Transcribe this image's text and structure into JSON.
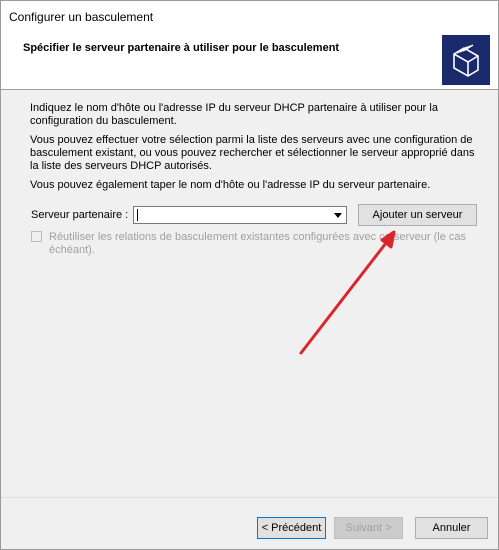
{
  "window": {
    "title": "Configurer un basculement"
  },
  "header": {
    "title": "Spécifier le serveur partenaire à utiliser pour le basculement",
    "icon": "folders-icon"
  },
  "content": {
    "paragraph1": "Indiquez le nom d'hôte ou l'adresse IP du serveur DHCP partenaire à utiliser pour la configuration du basculement.",
    "paragraph2": "Vous pouvez effectuer votre sélection parmi la liste des serveurs avec une configuration de basculement existant, ou vous pouvez rechercher et sélectionner le serveur approprié dans la liste des serveurs DHCP autorisés.",
    "paragraph3": "Vous pouvez également taper le nom d'hôte ou l'adresse IP du serveur partenaire."
  },
  "form": {
    "partner_label": "Serveur partenaire :",
    "partner_value": "",
    "add_server_label": "Ajouter un serveur",
    "reuse_checkbox_label": "Réutiliser les relations de basculement existantes configurées avec ce serveur (le cas échéant).",
    "reuse_checked": false
  },
  "footer": {
    "prev_label": "< Précédent",
    "next_label": "Suivant >",
    "cancel_label": "Annuler"
  },
  "colors": {
    "annotation_arrow": "#d9262a",
    "header_icon_bg": "#1a2a6c"
  }
}
